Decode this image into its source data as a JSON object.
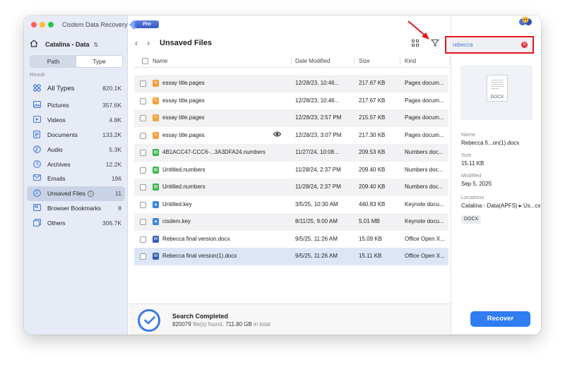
{
  "app": {
    "title": "Cisdem Data Recovery",
    "badge": "Pro"
  },
  "sidebar": {
    "drive": "Catalina - Data",
    "segments": [
      "Path",
      "Type"
    ],
    "active_segment": "Type",
    "result_label": "Result",
    "items": [
      {
        "label": "All Types",
        "count": "820.1K",
        "icon": "all-types-icon"
      },
      {
        "label": "Pictures",
        "count": "357.6K",
        "icon": "pictures-icon"
      },
      {
        "label": "Videos",
        "count": "4.8K",
        "icon": "videos-icon"
      },
      {
        "label": "Documents",
        "count": "133.2K",
        "icon": "documents-icon"
      },
      {
        "label": "Audio",
        "count": "5.3K",
        "icon": "audio-icon"
      },
      {
        "label": "Archives",
        "count": "12.2K",
        "icon": "archives-icon"
      },
      {
        "label": "Emails",
        "count": "196",
        "icon": "emails-icon"
      },
      {
        "label": "Unsaved Files",
        "count": "11",
        "icon": "unsaved-files-icon",
        "info": "i"
      },
      {
        "label": "Browser Bookmarks",
        "count": "8",
        "icon": "bookmarks-icon"
      },
      {
        "label": "Others",
        "count": "306.7K",
        "icon": "others-icon"
      }
    ]
  },
  "main": {
    "title": "Unsaved Files",
    "columns": {
      "name": "Name",
      "date": "Date Modified",
      "size": "Size",
      "kind": "Kind"
    },
    "rows": [
      {
        "type": "pages",
        "name": "essay title.pages",
        "date": "12/28/23, 10:46...",
        "size": "217.67 KB",
        "kind": "Pages docum..."
      },
      {
        "type": "pages",
        "name": "essay title.pages",
        "date": "12/28/23, 10:46...",
        "size": "217.67 KB",
        "kind": "Pages docum..."
      },
      {
        "type": "pages",
        "name": "essay title.pages",
        "date": "12/28/23, 2:57 PM",
        "size": "215.57 KB",
        "kind": "Pages docum..."
      },
      {
        "type": "pages",
        "name": "essay title.pages",
        "date": "12/28/23, 3:07 PM",
        "size": "217.30 KB",
        "kind": "Pages docum..."
      },
      {
        "type": "numbers",
        "name": "4B1ACC47-CCC6-...3A3DFA24.numbers",
        "date": "11/27/24, 10:08...",
        "size": "209.53 KB",
        "kind": "Numbers doc..."
      },
      {
        "type": "numbers",
        "name": "Untitled.numbers",
        "date": "11/28/24, 2:37 PM",
        "size": "209.40 KB",
        "kind": "Numbers doc..."
      },
      {
        "type": "numbers",
        "name": "Untitled.numbers",
        "date": "11/28/24, 2:37 PM",
        "size": "209.40 KB",
        "kind": "Numbers doc..."
      },
      {
        "type": "key",
        "name": "Untitled.key",
        "date": "3/5/25, 10:30 AM",
        "size": "440.83 KB",
        "kind": "Keynote docu..."
      },
      {
        "type": "key",
        "name": "cisdem.key",
        "date": "8/11/25, 9:00 AM",
        "size": "5.01 MB",
        "kind": "Keynote docu..."
      },
      {
        "type": "docx",
        "name": "Rebecca final version.docx",
        "date": "9/5/25, 11:26 AM",
        "size": "15.09 KB",
        "kind": "Office Open X..."
      },
      {
        "type": "docx",
        "name": "Rebecca final version(1).docx",
        "date": "9/5/25, 11:26 AM",
        "size": "15.11 KB",
        "kind": "Office Open X..."
      }
    ]
  },
  "status": {
    "title": "Search Completed",
    "count": "820079",
    "files_found": "file(s) found,",
    "total_size": "711.80 GB",
    "in_total": "in total"
  },
  "search": {
    "value": "rebecca"
  },
  "preview": {
    "thumb_label": "DOCX",
    "name_label": "Name",
    "name_value": "Rebecca fi...on(1).docx",
    "size_label": "Size",
    "size_value": "15.11 KB",
    "modified_label": "Modified",
    "modified_value": "Sep 5, 2025",
    "locations_label": "Locations",
    "locations_value": "Catalina - Data(APFS) ▸ Us...cx",
    "tag": "DOCX"
  },
  "actions": {
    "recover": "Recover"
  },
  "colors": {
    "accent": "#2f7df1",
    "highlight": "#e3141c",
    "sidebar_bg": "#e6ebf6"
  }
}
